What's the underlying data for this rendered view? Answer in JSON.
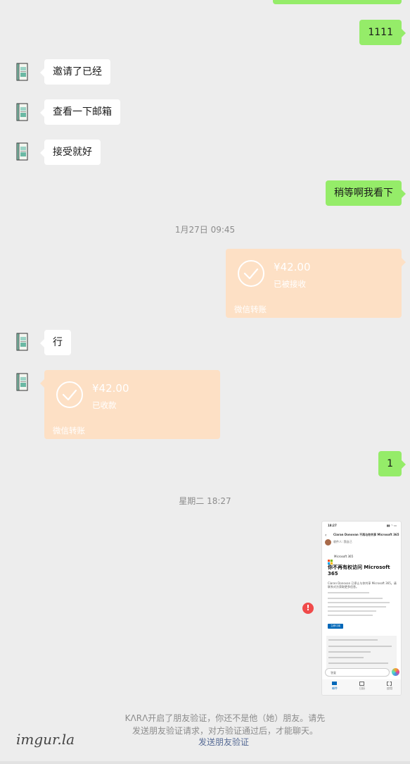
{
  "messages": {
    "m1111": "1111",
    "invited": "邀请了已经",
    "check_mail": "查看一下邮箱",
    "accept": "接受就好",
    "wait": "稍等啊我看下",
    "ok": "行",
    "one": "1"
  },
  "timestamps": {
    "t1": "1月27日 09:45",
    "t2": "星期二 18:27"
  },
  "transfer_right": {
    "amount": "¥42.00",
    "status": "已被接收",
    "brand": "微信转账"
  },
  "transfer_left": {
    "amount": "¥42.00",
    "status": "已收款",
    "brand": "微信转账"
  },
  "screenshot": {
    "time": "18:27",
    "subject": "Ciaran Donovan 不再与你共享 Microsoft 365",
    "sender": "收件人: 我自己",
    "logo": "Microsoft 365",
    "headline": "你不再有权访问 Microsoft 365",
    "body": "Ciaran Donovan 已停止与你共享 Microsoft 365。请联系对方获取更多信息。",
    "button": "立即订阅",
    "reply": "答复",
    "tab_mail": "邮件",
    "tab_calendar": "日历",
    "tab_apps": "应用"
  },
  "error_icon": "!",
  "notice": {
    "text": "KΛRΛ开启了朋友验证，你还不是他（她）朋友。请先发送朋友验证请求，对方验证通过后，才能聊天。",
    "link": "发送朋友验证"
  },
  "watermark": "imgur.la",
  "colors": {
    "background": "#ededed",
    "bubble_self": "#95ec69",
    "bubble_other": "#ffffff",
    "transfer": "#fde0c5",
    "link": "#576b95",
    "error": "#f04a4a"
  }
}
